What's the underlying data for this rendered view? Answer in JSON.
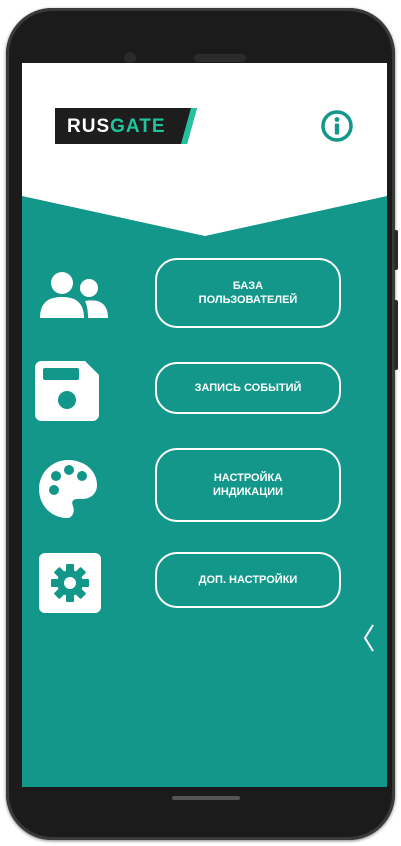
{
  "app": {
    "logo": {
      "part1": "RUS",
      "part2": "GATE"
    },
    "info_icon": "info-icon",
    "colors": {
      "primary": "#12978a",
      "accent": "#21c39f",
      "logo_bg": "#1d1d1d"
    }
  },
  "menu": {
    "items": [
      {
        "icon": "users-icon",
        "line1": "БАЗА",
        "line2": "ПОЛЬЗОВАТЕЛЕЙ"
      },
      {
        "icon": "floppy-disk-icon",
        "line1": "ЗАПИСЬ СОБЫТИЙ",
        "line2": ""
      },
      {
        "icon": "palette-icon",
        "line1": "НАСТРОЙКА",
        "line2": "ИНДИКАЦИИ"
      },
      {
        "icon": "gear-icon",
        "line1": "ДОП. НАСТРОЙКИ",
        "line2": ""
      }
    ]
  },
  "drawer_handle_icon": "chevron-left-icon"
}
